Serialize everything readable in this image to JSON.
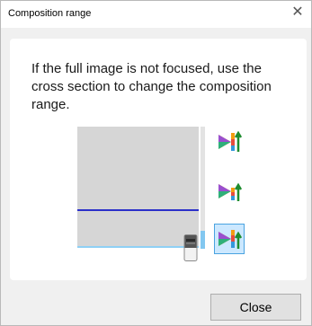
{
  "window": {
    "title": "Composition range",
    "close_glyph": "✕"
  },
  "message": "If the full image is not focused, use the cross section to change the composition range.",
  "colors": {
    "background": "#f0f0f0",
    "panel": "#ffffff",
    "preview": "#d6d6d6",
    "line_blue": "#2b30c9",
    "line_light": "#8fd0f5",
    "slider_fill": "#82c7f0",
    "selection": "#cce8ff"
  },
  "icons": {
    "window_close": "close-icon",
    "mode_button": "composition-range-icon",
    "thumb": "slider-thumb-icon"
  },
  "mode_buttons": [
    {
      "name": "range-mode-1",
      "selected": false
    },
    {
      "name": "range-mode-2",
      "selected": false
    },
    {
      "name": "range-mode-3",
      "selected": true
    }
  ],
  "buttons": {
    "close": "Close"
  }
}
